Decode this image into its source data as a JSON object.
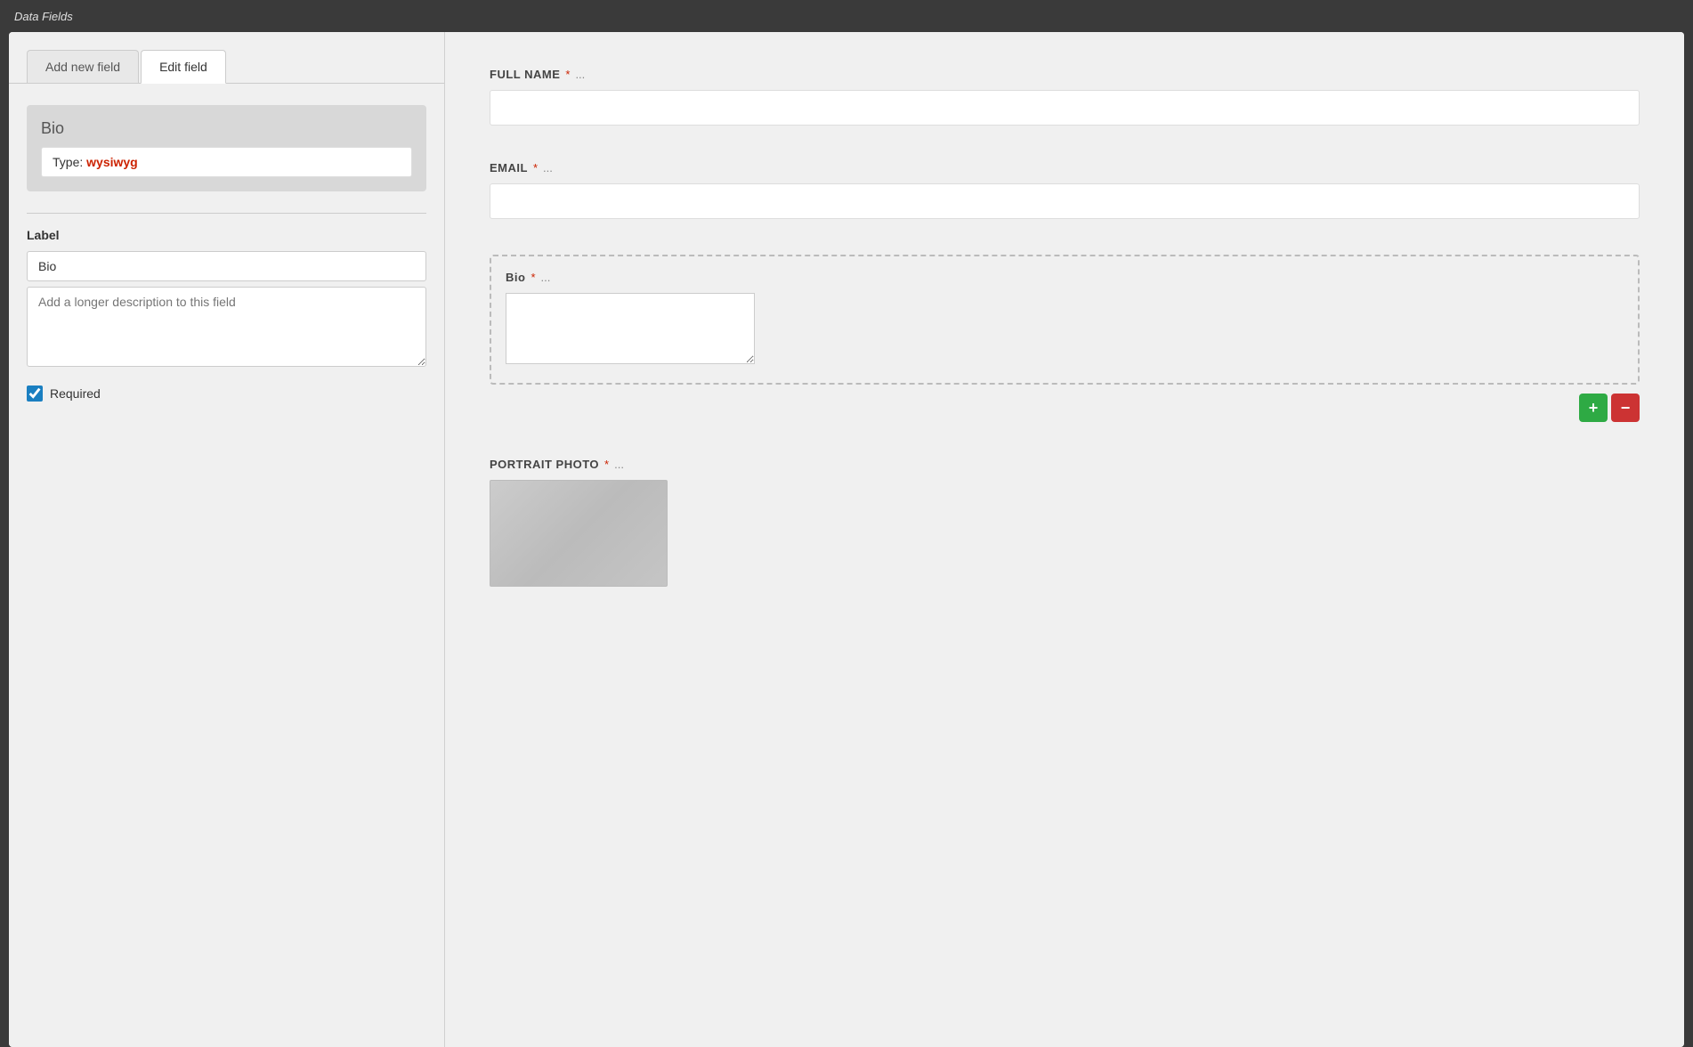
{
  "topBar": {
    "title": "Data Fields"
  },
  "tabs": [
    {
      "id": "add-new-field",
      "label": "Add new field",
      "active": false
    },
    {
      "id": "edit-field",
      "label": "Edit field",
      "active": true
    }
  ],
  "fieldPreview": {
    "name": "Bio",
    "typeLabel": "Type:",
    "typeValue": "wysiwyg"
  },
  "editForm": {
    "labelSectionTitle": "Label",
    "labelValue": "Bio",
    "descriptionPlaceholder": "Add a longer description to this field",
    "requiredLabel": "Required",
    "requiredChecked": true
  },
  "rightPanel": {
    "fields": [
      {
        "id": "full-name",
        "label": "FULL NAME",
        "required": true,
        "dots": "...",
        "type": "text"
      },
      {
        "id": "email",
        "label": "EMAIL",
        "required": true,
        "dots": "...",
        "type": "text"
      },
      {
        "id": "bio",
        "label": "Bio",
        "required": true,
        "dots": "...",
        "type": "wysiwyg"
      },
      {
        "id": "portrait-photo",
        "label": "PORTRAIT PHOTO",
        "required": true,
        "dots": "...",
        "type": "image"
      }
    ],
    "addButtonLabel": "+",
    "removeButtonLabel": "−"
  }
}
